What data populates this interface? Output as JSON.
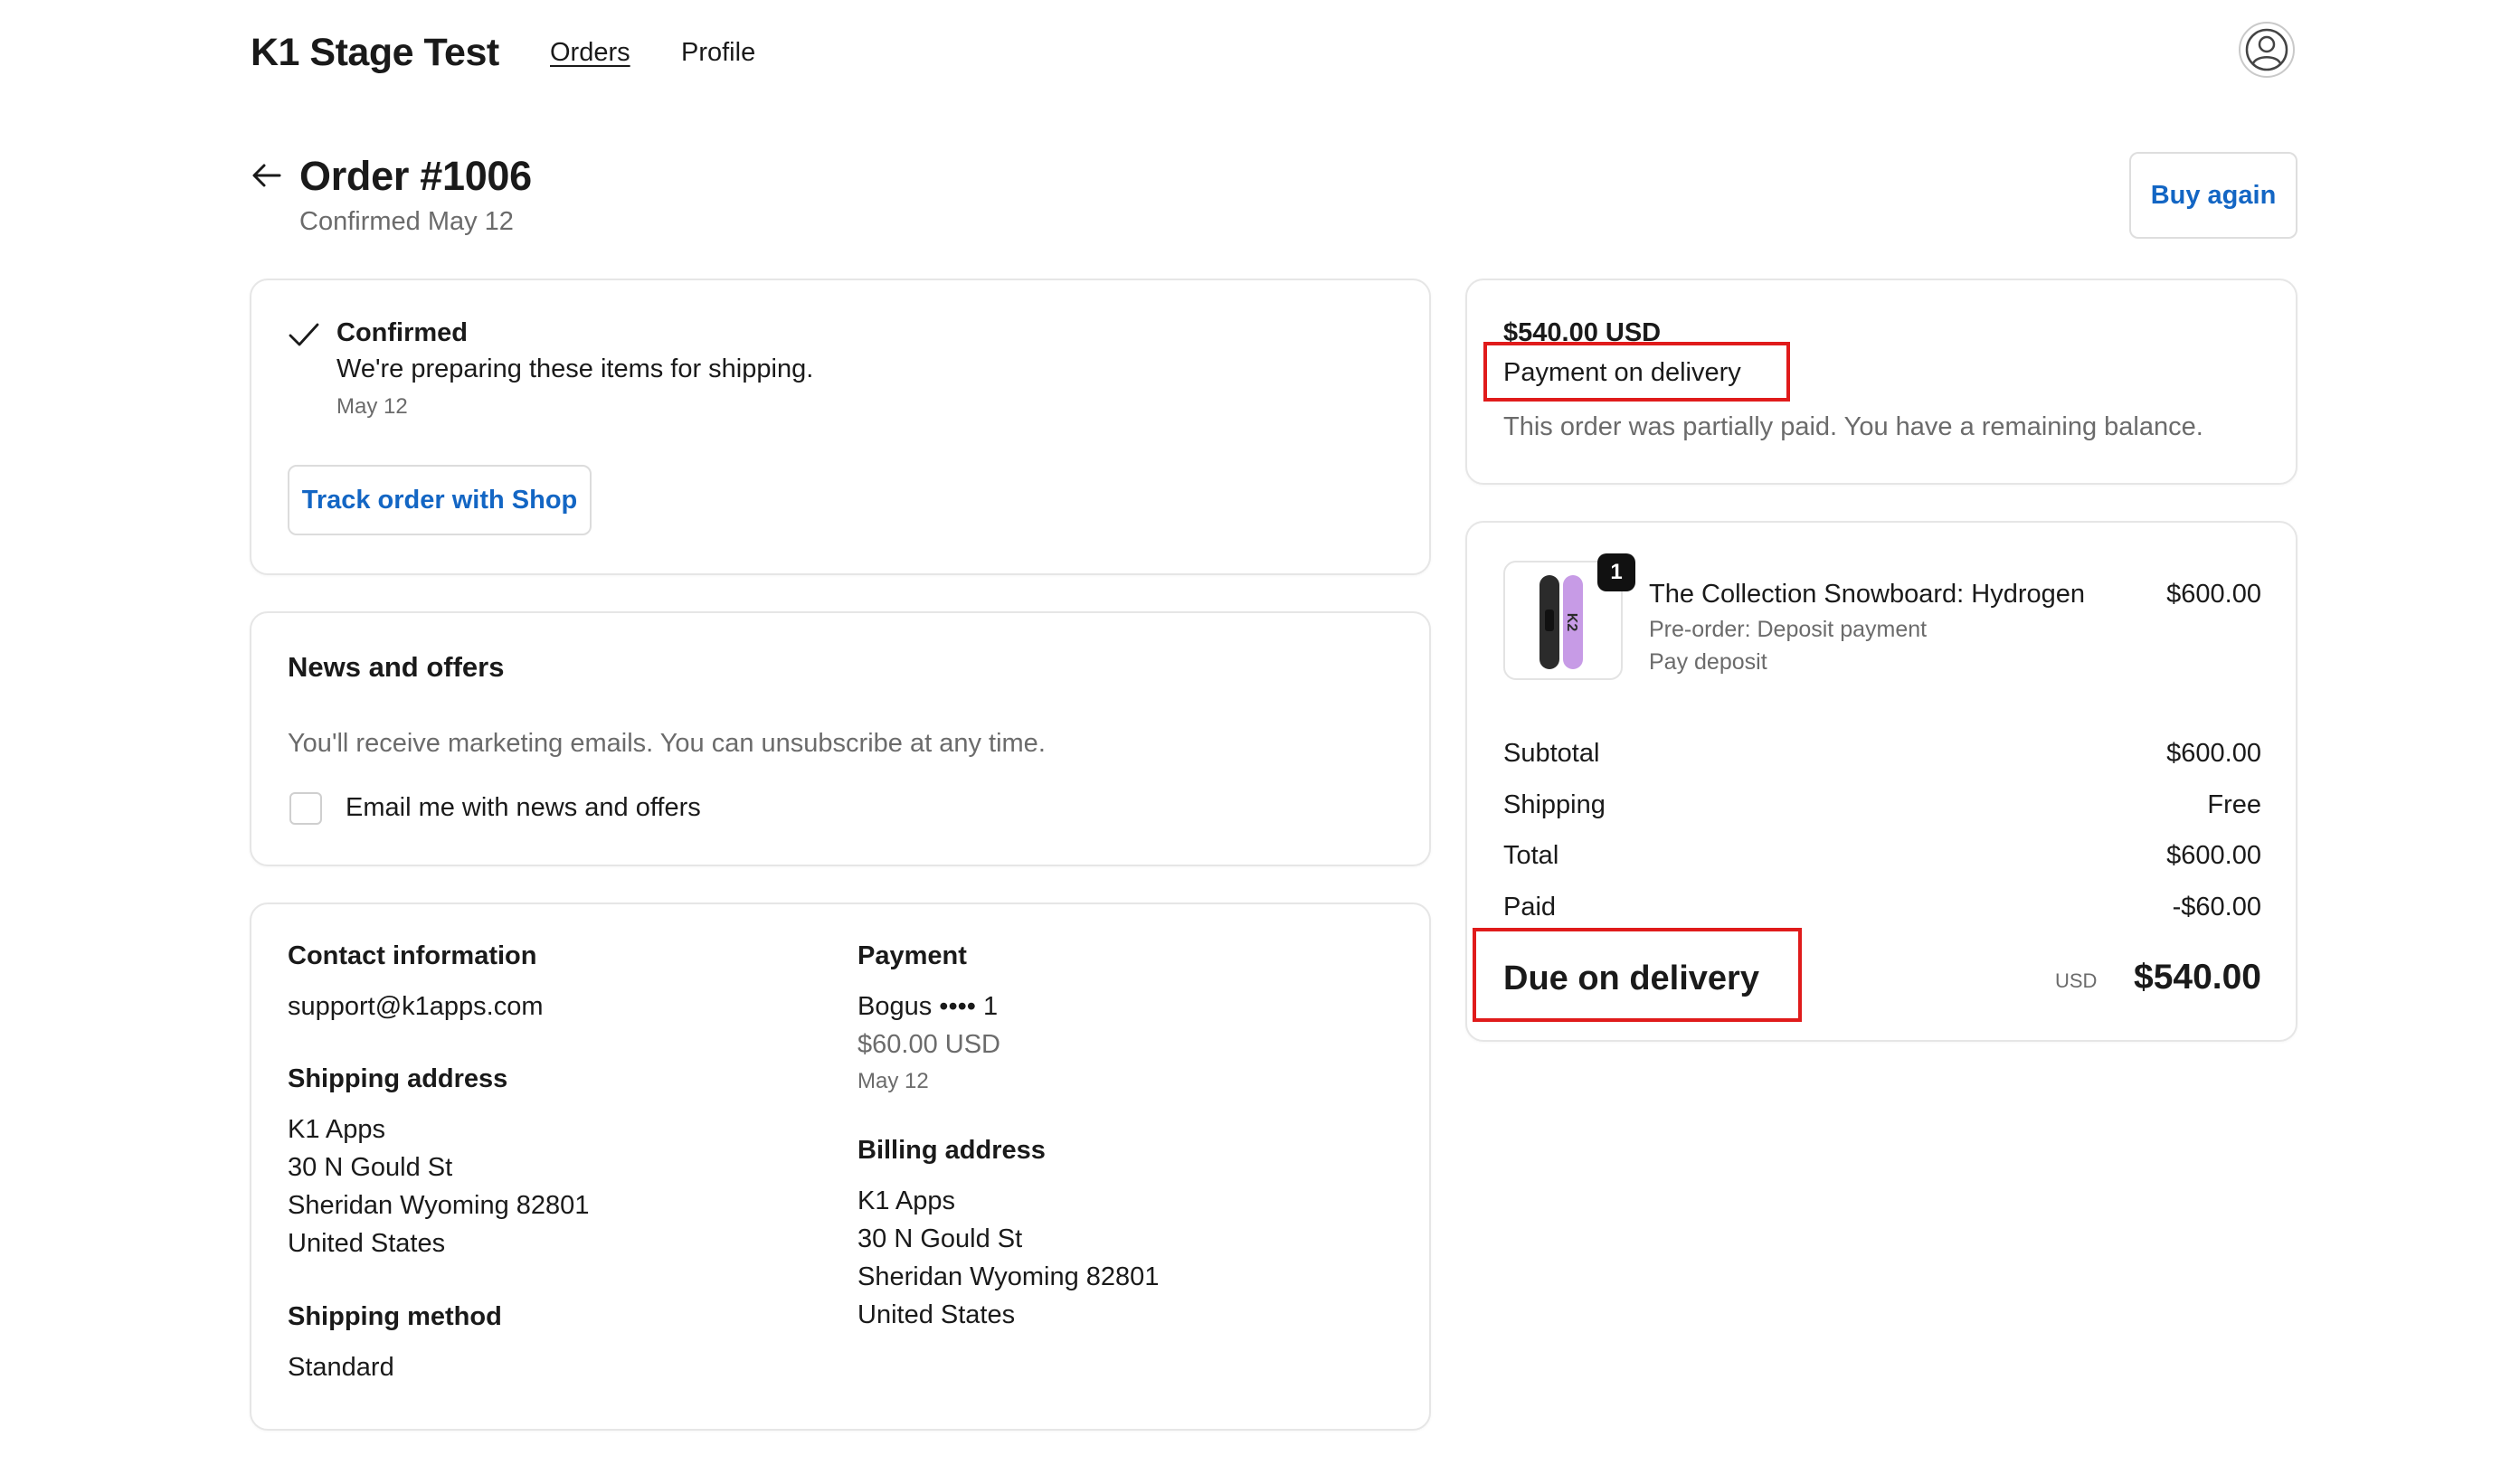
{
  "header": {
    "shop_name": "K1 Stage Test",
    "nav_orders": "Orders",
    "nav_profile": "Profile",
    "avatar_icon": "user-circle-icon"
  },
  "order": {
    "title": "Order #1006",
    "subtitle": "Confirmed May 12",
    "buy_again": "Buy again"
  },
  "status": {
    "title": "Confirmed",
    "message": "We're preparing these items for shipping.",
    "date": "May 12",
    "track_button": "Track order with Shop"
  },
  "news": {
    "title": "News and offers",
    "description": "You'll receive marketing emails. You can unsubscribe at any time.",
    "checkbox_label": "Email me with news and offers",
    "checked": false
  },
  "info": {
    "contact_heading": "Contact information",
    "contact_email": "support@k1apps.com",
    "shipping_address_heading": "Shipping address",
    "shipping_address": [
      "K1 Apps",
      "30 N Gould St",
      "Sheridan Wyoming 82801",
      "United States"
    ],
    "shipping_method_heading": "Shipping method",
    "shipping_method": "Standard",
    "payment_heading": "Payment",
    "payment_method": "Bogus •••• 1",
    "payment_amount": "$60.00 USD",
    "payment_date": "May 12",
    "billing_address_heading": "Billing address",
    "billing_address": [
      "K1 Apps",
      "30 N Gould St",
      "Sheridan Wyoming 82801",
      "United States"
    ]
  },
  "payment_card": {
    "amount": "$540.00 USD",
    "method": "Payment on delivery",
    "note": "This order was partially paid. You have a remaining balance."
  },
  "summary": {
    "item": {
      "quantity": "1",
      "name": "The Collection Snowboard: Hydrogen",
      "price": "$600.00",
      "line1": "Pre-order: Deposit payment",
      "line2": "Pay deposit"
    },
    "rows": [
      {
        "label": "Subtotal",
        "value": "$600.00"
      },
      {
        "label": "Shipping",
        "value": "Free"
      },
      {
        "label": "Total",
        "value": "$600.00"
      },
      {
        "label": "Paid",
        "value": "-$60.00"
      }
    ],
    "due_label": "Due on delivery",
    "due_currency": "USD",
    "due_amount": "$540.00"
  },
  "colors": {
    "accent": "#1366c4",
    "highlight": "#e01b1b",
    "muted_text": "#6b6b6b"
  }
}
